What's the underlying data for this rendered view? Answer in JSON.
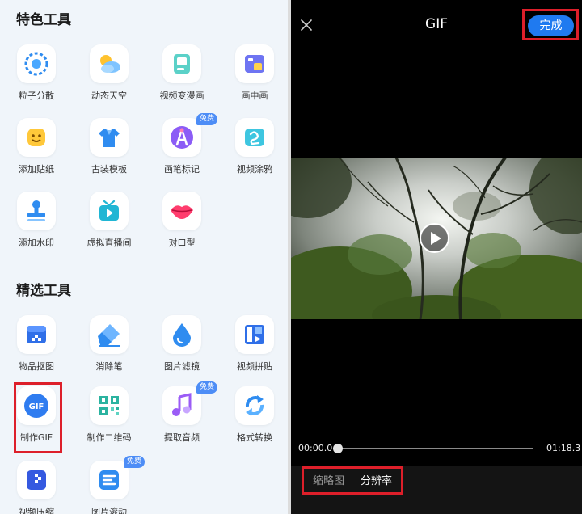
{
  "left": {
    "sections": [
      {
        "title": "特色工具"
      },
      {
        "title": "精选工具"
      }
    ],
    "featured_tools": [
      {
        "label": "粒子分散",
        "icon": "particle-icon"
      },
      {
        "label": "动态天空",
        "icon": "sky-icon"
      },
      {
        "label": "视频变漫画",
        "icon": "comic-icon"
      },
      {
        "label": "画中画",
        "icon": "pip-icon"
      },
      {
        "label": "添加贴纸",
        "icon": "sticker-icon"
      },
      {
        "label": "古装模板",
        "icon": "costume-icon"
      },
      {
        "label": "画笔标记",
        "icon": "brush-icon",
        "badge": "免费"
      },
      {
        "label": "视频涂鸦",
        "icon": "doodle-icon"
      },
      {
        "label": "添加水印",
        "icon": "watermark-icon"
      },
      {
        "label": "虚拟直播间",
        "icon": "live-icon"
      },
      {
        "label": "对口型",
        "icon": "lips-icon"
      }
    ],
    "selected_tools": [
      {
        "label": "物品抠图",
        "icon": "cutout-icon"
      },
      {
        "label": "消除笔",
        "icon": "eraser-icon"
      },
      {
        "label": "图片滤镜",
        "icon": "filter-icon"
      },
      {
        "label": "视频拼贴",
        "icon": "collage-icon"
      },
      {
        "label": "制作GIF",
        "icon": "gif-icon",
        "icon_text": "GIF"
      },
      {
        "label": "制作二维码",
        "icon": "qrcode-icon"
      },
      {
        "label": "提取音频",
        "icon": "audio-icon",
        "badge": "免费"
      },
      {
        "label": "格式转换",
        "icon": "convert-icon"
      },
      {
        "label": "视频压缩",
        "icon": "compress-icon"
      },
      {
        "label": "图片滚动",
        "icon": "scroll-icon",
        "badge": "免费"
      }
    ]
  },
  "right": {
    "title": "GIF",
    "done_label": "完成",
    "time_start": "00:00.0",
    "time_end": "01:18.3",
    "progress": 0,
    "tabs": [
      {
        "label": "缩略图",
        "active": false
      },
      {
        "label": "分辨率",
        "active": true
      }
    ]
  },
  "colors": {
    "accent": "#1f7af0",
    "highlight": "#dd1f2a",
    "badge": "#4d8df6"
  }
}
